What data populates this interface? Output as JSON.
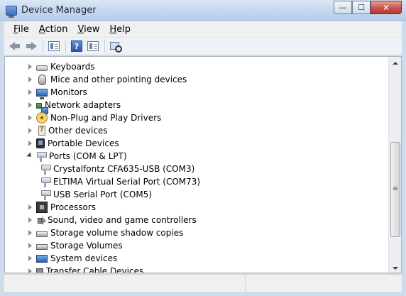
{
  "window": {
    "title": "Device Manager",
    "app_icon": "device-manager-icon",
    "controls": {
      "minimize": "—",
      "maximize": "☐",
      "close": "✕"
    }
  },
  "menu": [
    {
      "label": "File",
      "accel": "F",
      "rest": "ile"
    },
    {
      "label": "Action",
      "accel": "A",
      "rest": "ction"
    },
    {
      "label": "View",
      "accel": "V",
      "rest": "iew"
    },
    {
      "label": "Help",
      "accel": "H",
      "rest": "elp"
    }
  ],
  "toolbar": {
    "buttons": [
      "back-arrow-icon",
      "forward-arrow-icon",
      "properties-icon",
      "help-icon",
      "show-hide-icon",
      "scan-hardware-icon"
    ],
    "help_glyph": "?"
  },
  "tree": {
    "items": [
      {
        "label": "Keyboards",
        "icon": "keyboard-icon",
        "expanded": false,
        "level": 0
      },
      {
        "label": "Mice and other pointing devices",
        "icon": "mouse-icon",
        "expanded": false,
        "level": 0
      },
      {
        "label": "Monitors",
        "icon": "monitor-icon",
        "expanded": false,
        "level": 0
      },
      {
        "label": "Network adapters",
        "icon": "network-adapter-icon",
        "expanded": false,
        "level": 0
      },
      {
        "label": "Non-Plug and Play Drivers",
        "icon": "driver-icon",
        "expanded": false,
        "level": 0
      },
      {
        "label": "Other devices",
        "icon": "unknown-device-icon",
        "expanded": false,
        "level": 0
      },
      {
        "label": "Portable Devices",
        "icon": "portable-device-icon",
        "expanded": false,
        "level": 0
      },
      {
        "label": "Ports (COM & LPT)",
        "icon": "port-icon",
        "expanded": true,
        "level": 0
      },
      {
        "label": "Crystalfontz CFA635-USB (COM3)",
        "icon": "port-icon",
        "level": 1
      },
      {
        "label": "ELTIMA Virtual Serial Port (COM73)",
        "icon": "port-icon",
        "level": 1
      },
      {
        "label": "USB Serial Port (COM5)",
        "icon": "port-icon",
        "level": 1
      },
      {
        "label": "Processors",
        "icon": "processor-icon",
        "expanded": false,
        "level": 0
      },
      {
        "label": "Sound, video and game controllers",
        "icon": "speaker-icon",
        "expanded": false,
        "level": 0
      },
      {
        "label": "Storage volume shadow copies",
        "icon": "storage-icon",
        "expanded": false,
        "level": 0
      },
      {
        "label": "Storage Volumes",
        "icon": "storage-icon",
        "expanded": false,
        "level": 0
      },
      {
        "label": "System devices",
        "icon": "system-device-icon",
        "expanded": false,
        "level": 0
      },
      {
        "label": "Transfer Cable Devices",
        "icon": "cable-icon",
        "expanded": false,
        "level": 0
      }
    ]
  }
}
